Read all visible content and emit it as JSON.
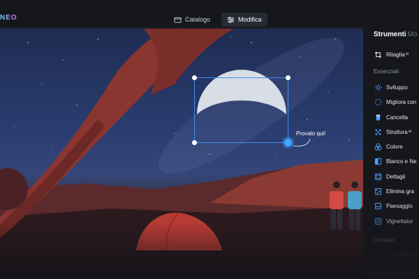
{
  "app": {
    "logo": "NEO"
  },
  "topbar": {
    "tabs": [
      {
        "label": "Catalogo",
        "icon": "folder-icon",
        "active": false
      },
      {
        "label": "Modifica",
        "icon": "sliders-icon",
        "active": true
      }
    ]
  },
  "canvas": {
    "hint": "Provalo qui!"
  },
  "panel": {
    "tab_active": "Strumenti",
    "tab_inactive": "Mo",
    "crop_label": "Ritaglia",
    "ai_badge": "AI",
    "section_essentials": "Essenziali",
    "tools": [
      {
        "label": "Sviluppo",
        "icon": "sun-icon",
        "ai": false
      },
      {
        "label": "Migliora con",
        "icon": "sparkle-icon",
        "ai": false
      },
      {
        "label": "Cancella",
        "icon": "eraser-icon",
        "ai": false
      },
      {
        "label": "Struttura",
        "icon": "structure-icon",
        "ai": true
      },
      {
        "label": "Colore",
        "icon": "color-icon",
        "ai": false
      },
      {
        "label": "Bianco e Ne",
        "icon": "bw-icon",
        "ai": false
      },
      {
        "label": "Dettagli",
        "icon": "details-icon",
        "ai": false
      },
      {
        "label": "Elimina gra",
        "icon": "grain-icon",
        "ai": false
      },
      {
        "label": "Paesaggio",
        "icon": "landscape-icon",
        "ai": false
      },
      {
        "label": "Vignettatur",
        "icon": "vignette-icon",
        "ai": false
      }
    ],
    "section_creative": "Creativo",
    "creative_first": "Luce magica"
  },
  "colors": {
    "accent": "#3d8df0",
    "panel_bg": "#15171d",
    "topbar_bg": "#15171d",
    "icon_blue": "#4aa3ff"
  }
}
